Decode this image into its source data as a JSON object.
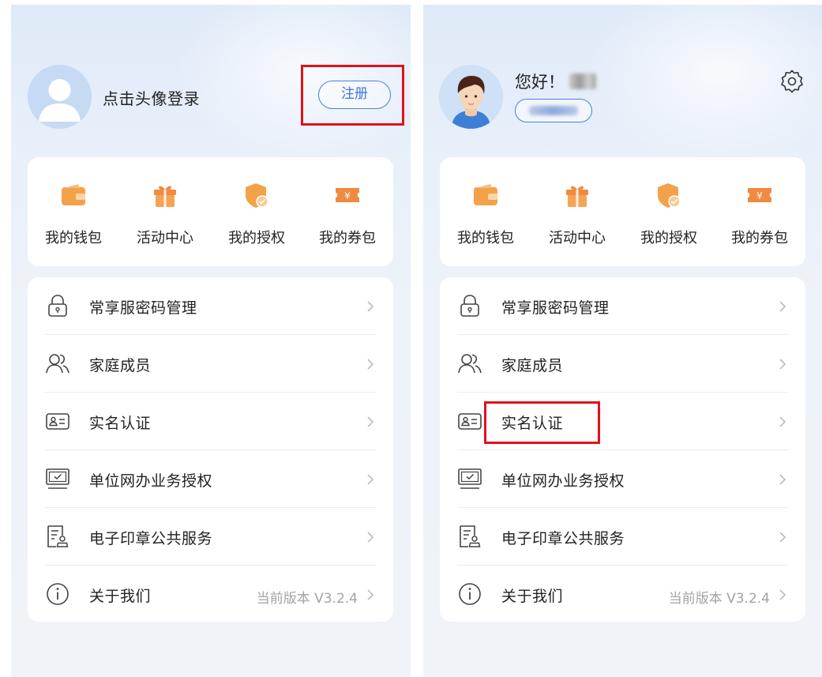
{
  "colors": {
    "accent": "#4a7fe0",
    "icon_orange": "#f29a3c",
    "highlight": "#e0121b",
    "text": "#222222",
    "muted": "#a3a3a3"
  },
  "left": {
    "login_text": "点击头像登录",
    "register_label": "注册"
  },
  "right": {
    "greeting": "您好！"
  },
  "quick": [
    {
      "label": "我的钱包",
      "icon": "wallet-icon"
    },
    {
      "label": "活动中心",
      "icon": "gift-icon"
    },
    {
      "label": "我的授权",
      "icon": "shield-check-icon"
    },
    {
      "label": "我的券包",
      "icon": "coupon-icon"
    }
  ],
  "menu": [
    {
      "label": "常享服密码管理",
      "icon": "lock-icon"
    },
    {
      "label": "家庭成员",
      "icon": "family-icon"
    },
    {
      "label": "实名认证",
      "icon": "id-card-icon"
    },
    {
      "label": "单位网办业务授权",
      "icon": "monitor-check-icon"
    },
    {
      "label": "电子印章公共服务",
      "icon": "seal-document-icon"
    },
    {
      "label": "关于我们",
      "icon": "info-icon",
      "value": "当前版本 V3.2.4"
    }
  ]
}
